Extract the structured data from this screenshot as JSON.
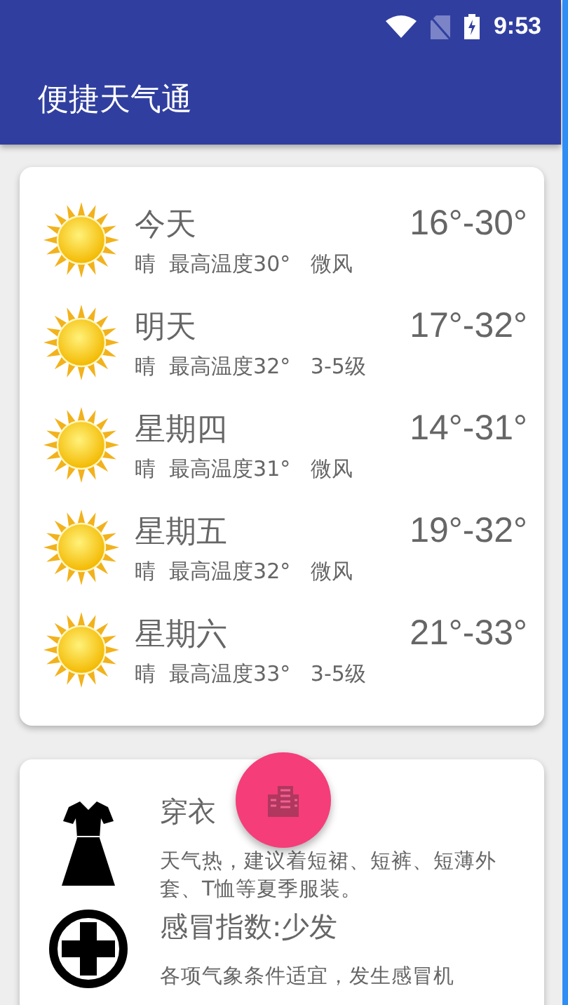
{
  "status_bar": {
    "time": "9:53"
  },
  "app_bar": {
    "title": "便捷天气通"
  },
  "forecast": [
    {
      "kind": "sunny",
      "day": "今天",
      "range": "16°-30°",
      "detail": "晴  最高温度30°   微风"
    },
    {
      "kind": "sunny",
      "day": "明天",
      "range": "17°-32°",
      "detail": "晴  最高温度32°   3-5级"
    },
    {
      "kind": "sunny",
      "day": "星期四",
      "range": "14°-31°",
      "detail": "晴  最高温度31°   微风"
    },
    {
      "kind": "sunny",
      "day": "星期五",
      "range": "19°-32°",
      "detail": "晴  最高温度32°   微风"
    },
    {
      "kind": "sunny",
      "day": "星期六",
      "range": "21°-33°",
      "detail": "晴  最高温度33°   3-5级"
    }
  ],
  "indices": [
    {
      "kind": "clothing",
      "title": "穿衣",
      "detail": "天气热，建议着短裙、短裤、短薄外套、T恤等夏季服装。"
    },
    {
      "kind": "cold",
      "title": "感冒指数:少发",
      "detail": "各项气象条件适宜，发生感冒机"
    }
  ]
}
